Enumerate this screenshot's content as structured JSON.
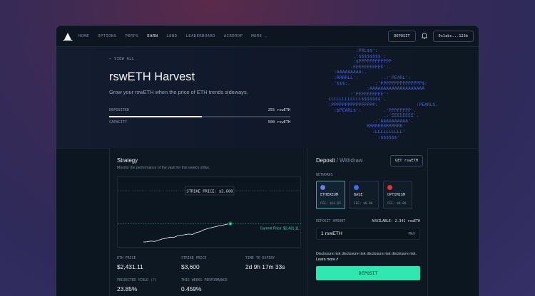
{
  "nav": {
    "items": [
      "HOME",
      "OPTIONS",
      "PERPS",
      "EARN",
      "LEND",
      "LEADERBOARD",
      "AIRDROP",
      "MORE"
    ],
    "active": "EARN",
    "deposit_label": "DEPOSIT",
    "wallet": "0x1abc...123b"
  },
  "hero": {
    "back_label": "VIEW ALL",
    "title": "rswETH Harvest",
    "subtitle": "Grow your rswETH when the price of ETH trends sideways.",
    "deposited_label": "DEPOSITED",
    "deposited_value": "255 rswETH",
    "deposited_fraction": 0.51,
    "capacity_label": "CAPACITY",
    "capacity_value": "500 rswETH",
    "ascii_art": [
      "              :PRL$$':",
      "             .'$$$$$$$$':",
      "             :$PPPPPPPPPPPP",
      "            :EEEEEEEEEEE':.",
      "      :AAAAAAAAA:.",
      "      :RRRRLL':         .:'PEARL':",
      "     .'$$$:.         :'PPPPPPPPPPPPPPP$:",
      "                  :AAAAAAAAAAAAAAAAAAAA",
      "           .:'EEEEEEEEEE':",
      "    LLLLLLLLLLLL$$$$$$$'.",
      "    :PPPPPPPPPPPPPPPP:              :PEARLS.",
      "      :$PEARL$':        .'PPPPPPPP'.",
      "                        .:'EEEEEEEE'.",
      "                    .:'AAAAAAAAAA'.",
      "                  RRRRRRRRRRRRR'",
      "                    :LLLLLLLLLL'",
      "                      :$$$$$$'"
    ]
  },
  "strategy": {
    "title": "Strategy",
    "subtitle": "Monitor the performance of the vault for this week's strike.",
    "strike_label": "STRIKE PRICE: $3,600",
    "current_label": "Current Price: $2,431.11",
    "metrics": [
      {
        "label": "ETH PRICE",
        "value": "$2,431.11"
      },
      {
        "label": "STRIKE PRICE",
        "value": "$3,600"
      },
      {
        "label": "TIME TO EXPIRY",
        "value": "2d 9h 17m 33s"
      },
      {
        "label": "PROJECTED YIELD (?)",
        "value": "23.85%"
      },
      {
        "label": "THIS WEEKS PERFORMANCE",
        "value": "0.459%"
      }
    ]
  },
  "chart_data": {
    "type": "line",
    "series": [
      {
        "values": [
          0.02,
          0.03,
          0.05,
          0.04,
          0.08,
          0.12,
          0.14,
          0.18,
          0.17,
          0.22,
          0.24,
          0.26,
          0.28,
          0.27,
          0.33,
          0.36,
          0.42,
          0.46,
          0.49,
          0.52,
          0.55,
          0.57,
          0.6,
          0.62
        ]
      }
    ],
    "strike": "$3,600",
    "current": "$2,431.11",
    "grid": false
  },
  "deposit": {
    "tab_active": "Deposit",
    "tab_sep": " / ",
    "tab_inactive": "Withdraw",
    "get_label": "GET rswETH",
    "networks_label": "NETWORKS",
    "networks": [
      {
        "name": "ETHEREUM",
        "fee": "FEE: $14.65",
        "color": "#6f7ce8"
      },
      {
        "name": "BASE",
        "fee": "FEE: $0.00",
        "color": "#3c6cf0"
      },
      {
        "name": "OPTIMISM",
        "fee": "FEE: $0.00",
        "color": "#e8313b"
      }
    ],
    "amount_label": "DEPOSIT AMOUNT",
    "available": "AVAILABLE: 2.341 rswETH",
    "amount_value": "1 rswETH",
    "max_label": "MAX",
    "disclosure": "Disclosure risk disclosure risk disclosure risk disclosure risk.",
    "learn_more": "Learn more↗",
    "button": "DEPOSIT"
  }
}
